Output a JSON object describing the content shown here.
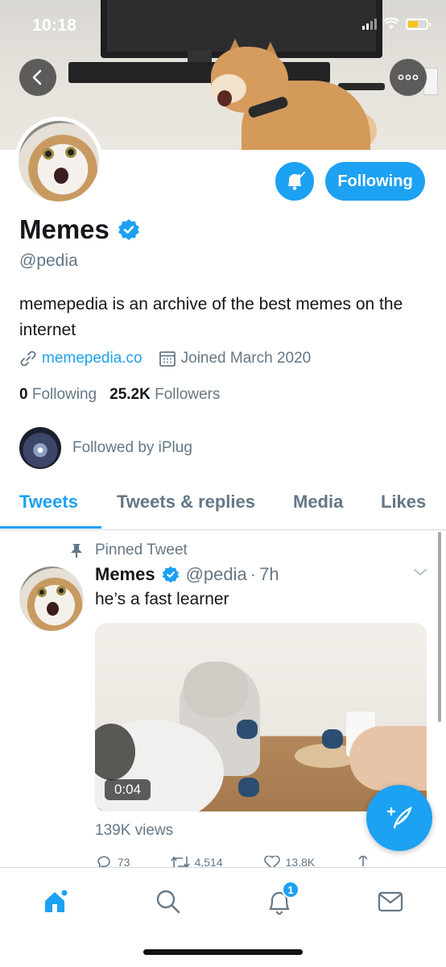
{
  "status_bar": {
    "time": "10:18",
    "battery_color": "#f5c518"
  },
  "profile": {
    "name": "Memes",
    "verified": true,
    "handle": "@pedia",
    "bio": "memepedia is an archive of the best memes on the internet",
    "link": "memepedia.co",
    "joined": "Joined March 2020",
    "following_count": "0",
    "following_label": "Following",
    "followers_count": "25.2K",
    "followers_label": "Followers",
    "followed_by": "Followed by iPlug",
    "follow_button_label": "Following"
  },
  "tabs": [
    {
      "label": "Tweets",
      "active": true
    },
    {
      "label": "Tweets & replies",
      "active": false
    },
    {
      "label": "Media",
      "active": false
    },
    {
      "label": "Likes",
      "active": false
    }
  ],
  "tweet": {
    "pinned_label": "Pinned Tweet",
    "author": "Memes",
    "handle": "@pedia",
    "separator": "·",
    "time": "7h",
    "text": "he’s a fast learner",
    "video_duration": "0:04",
    "views": "139K views",
    "replies": "73",
    "retweets": "4,514",
    "likes": "13.8K"
  },
  "bottom_nav": {
    "notifications_badge": "1"
  },
  "colors": {
    "accent": "#1da1f2",
    "text": "#14171a",
    "secondary": "#657786"
  }
}
